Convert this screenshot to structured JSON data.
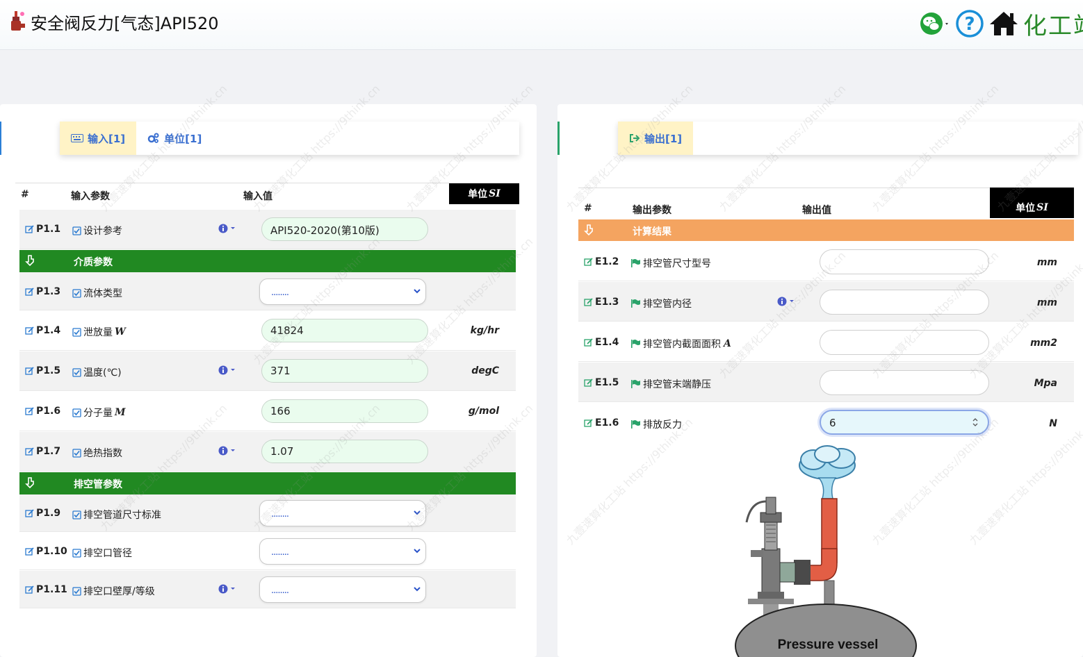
{
  "header": {
    "title": "安全阀反力[气态]API520",
    "brand": "化工站",
    "icons": [
      "wechat-icon",
      "help-icon",
      "home-icon"
    ]
  },
  "left_panel": {
    "tabs": [
      {
        "label": "输入[1]",
        "icon": "keyboard-icon",
        "active": true
      },
      {
        "label": "单位[1]",
        "icon": "gears-icon",
        "active": false
      }
    ],
    "columns": {
      "num": "#",
      "param": "输入参数",
      "value": "输入值",
      "unit_prefix": "单位",
      "unit_system": "SI"
    },
    "rows": [
      {
        "kind": "row",
        "id": "P1.1",
        "label": "设计参考",
        "info": true,
        "type": "input",
        "value": "API520-2020(第10版)",
        "unit": ""
      },
      {
        "kind": "section",
        "title": "介质参数"
      },
      {
        "kind": "row",
        "id": "P1.3",
        "label": "流体类型",
        "info": false,
        "type": "select",
        "value": "........",
        "unit": ""
      },
      {
        "kind": "row",
        "id": "P1.4",
        "label": "泄放量",
        "symbol": "W",
        "info": false,
        "type": "input",
        "value": "41824",
        "unit": "kg/hr"
      },
      {
        "kind": "row",
        "id": "P1.5",
        "label": "温度(℃)",
        "info": true,
        "type": "input",
        "value": "371",
        "unit": "degC"
      },
      {
        "kind": "row",
        "id": "P1.6",
        "label": "分子量",
        "symbol": "M",
        "info": false,
        "type": "input",
        "value": "166",
        "unit": "g/mol"
      },
      {
        "kind": "row",
        "id": "P1.7",
        "label": "绝热指数",
        "info": true,
        "type": "input",
        "value": "1.07",
        "unit": ""
      },
      {
        "kind": "section",
        "title": "排空管参数"
      },
      {
        "kind": "row",
        "id": "P1.9",
        "label": "排空管道尺寸标准",
        "info": false,
        "type": "select",
        "value": "........",
        "unit": ""
      },
      {
        "kind": "row",
        "id": "P1.10",
        "label": "排空口管径",
        "info": false,
        "type": "select",
        "value": "........",
        "unit": ""
      },
      {
        "kind": "row",
        "id": "P1.11",
        "label": "排空口壁厚/等级",
        "info": true,
        "type": "select",
        "value": "........",
        "unit": ""
      }
    ]
  },
  "right_panel": {
    "tabs": [
      {
        "label": "输出[1]",
        "icon": "sign-out-icon",
        "active": true
      }
    ],
    "columns": {
      "num": "#",
      "param": "输出参数",
      "value": "输出值",
      "unit_prefix": "单位",
      "unit_system": "SI"
    },
    "section": "计算结果",
    "rows": [
      {
        "id": "E1.2",
        "label": "排空管尺寸型号",
        "symbol": "",
        "info": false,
        "value": "",
        "unit": "mm"
      },
      {
        "id": "E1.3",
        "label": "排空管内径",
        "symbol": "",
        "info": true,
        "value": "",
        "unit": "mm"
      },
      {
        "id": "E1.4",
        "label": "排空管内截面面积",
        "symbol": "A",
        "info": false,
        "value": "",
        "unit": "mm2"
      },
      {
        "id": "E1.5",
        "label": "排空管末端静压",
        "symbol": "",
        "info": false,
        "value": "",
        "unit": "Mpa"
      },
      {
        "id": "E1.6",
        "label": "排放反力",
        "symbol": "",
        "info": false,
        "value": "6",
        "unit": "N"
      }
    ],
    "diagram": {
      "label": "Pressure vessel"
    }
  },
  "colors": {
    "section_green": "#218922",
    "section_orange": "#f4a460",
    "tab_active": "#fff3c6",
    "link_blue": "#3a6fd0"
  }
}
